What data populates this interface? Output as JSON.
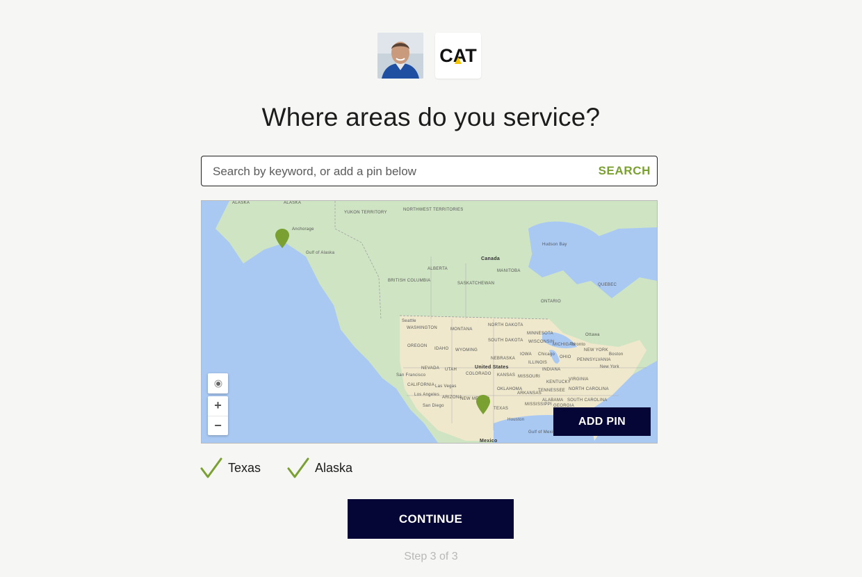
{
  "header": {
    "avatar_icon": "user-photo",
    "brand_logo_text": "CAT"
  },
  "page": {
    "title": "Where areas do you service?"
  },
  "search": {
    "placeholder": "Search by keyword, or add a pin below",
    "value": "",
    "button_label": "SEARCH"
  },
  "map": {
    "labels": {
      "alaska": "ALASKA",
      "yukon": "YUKON TERRITORY",
      "nwt": "NORTHWEST TERRITORIES",
      "anchorage": "Anchorage",
      "gulf_alaska": "Gulf of Alaska",
      "canada": "Canada",
      "hudson_bay": "Hudson Bay",
      "alberta": "ALBERTA",
      "manitoba": "MANITOBA",
      "bc": "BRITISH COLUMBIA",
      "sask": "SASKATCHEWAN",
      "ontario": "ONTARIO",
      "quebec": "QUEBEC",
      "seattle": "Seattle",
      "washington": "WASHINGTON",
      "montana": "MONTANA",
      "north_dakota": "NORTH DAKOTA",
      "minnesota": "MINNESOTA",
      "oregon": "OREGON",
      "idaho": "IDAHO",
      "wyoming": "WYOMING",
      "south_dakota": "SOUTH DAKOTA",
      "wisconsin": "WISCONSIN",
      "michigan": "MICHIGAN",
      "ottawa": "Ottawa",
      "toronto": "Toronto",
      "nevada": "NEVADA",
      "utah": "UTAH",
      "united_states": "United States",
      "nebraska": "NEBRASKA",
      "iowa": "IOWA",
      "illinois": "ILLINOIS",
      "chicago": "Chicago",
      "ohio": "OHIO",
      "pennsylvania": "PENNSYLVANIA",
      "new_york_state": "NEW YORK",
      "new_york": "New York",
      "boston": "Boston",
      "san_francisco": "San Francisco",
      "california": "CALIFORNIA",
      "colorado": "COLORADO",
      "kansas": "KANSAS",
      "missouri": "MISSOURI",
      "indiana": "INDIANA",
      "las_vegas": "Las Vegas",
      "kentucky": "KENTUCKY",
      "virginia": "VIRGINIA",
      "los_angeles": "Los Angeles",
      "arizona": "ARIZONA",
      "oklahoma": "OKLAHOMA",
      "tennessee": "TENNESSEE",
      "north_carolina": "NORTH CAROLINA",
      "san_diego": "San Diego",
      "new_mexico": "NEW MEXICO",
      "arkansas": "ARKANSAS",
      "south_carolina": "SOUTH CAROLINA",
      "mississippi": "MISSISSIPPI",
      "alabama": "ALABAMA",
      "georgia": "GEORGIA",
      "texas": "TEXAS",
      "houston": "Houston",
      "gulf_mexico": "Gulf of Mexico",
      "mexico": "Mexico"
    },
    "zoom_in_label": "+",
    "zoom_out_label": "−",
    "add_pin_label": "ADD PIN",
    "pin_color": "#7aa032"
  },
  "selected_areas": [
    {
      "label": "Texas"
    },
    {
      "label": "Alaska"
    }
  ],
  "continue_label": "CONTINUE",
  "step_text": "Step 3 of 3",
  "colors": {
    "accent": "#7aa032",
    "primary": "#050536",
    "background": "#f6f6f4"
  }
}
